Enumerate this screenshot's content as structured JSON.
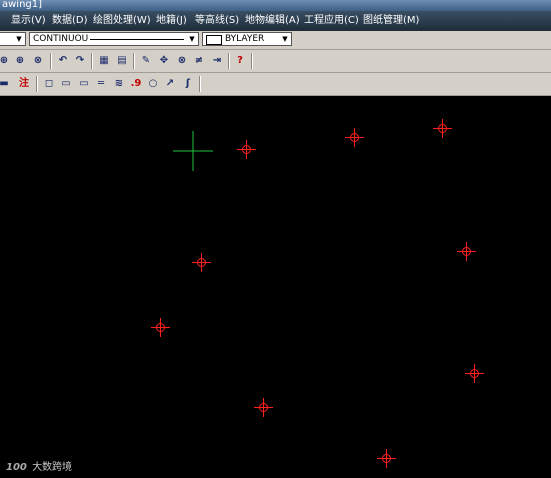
{
  "window": {
    "title": "awing1]"
  },
  "menu": [
    {
      "label": "显示(V)"
    },
    {
      "label": "数据(D)"
    },
    {
      "label": "绘图处理(W)"
    },
    {
      "label": "地籍(J)"
    },
    {
      "label": "等高线(S)"
    },
    {
      "label": "地物编辑(A)"
    },
    {
      "label": "工程应用(C)"
    },
    {
      "label": "图纸管理(M)"
    }
  ],
  "properties": {
    "layer": "",
    "linetype": "CONTINUOU",
    "color": "BYLAYER"
  },
  "toolbar1": [
    {
      "icon": "zoom-window-icon",
      "glyph": "⊕"
    },
    {
      "icon": "zoom-extents-icon",
      "glyph": "⊕"
    },
    {
      "icon": "zoom-previous-icon",
      "glyph": "⊗"
    },
    {
      "icon": "undo-icon",
      "glyph": "↶"
    },
    {
      "icon": "redo-icon",
      "glyph": "↷"
    },
    {
      "icon": "properties-icon",
      "glyph": "▦"
    },
    {
      "icon": "layer-list-icon",
      "glyph": "▤"
    },
    {
      "icon": "pencil-icon",
      "glyph": "✎"
    },
    {
      "icon": "move-icon",
      "glyph": "✥"
    },
    {
      "icon": "copy-icon",
      "glyph": "⊗"
    },
    {
      "icon": "trim-icon",
      "glyph": "≠"
    },
    {
      "icon": "extend-icon",
      "glyph": "⇥"
    },
    {
      "icon": "help-icon",
      "glyph": "?"
    }
  ],
  "toolbar2": [
    {
      "icon": "ruler-icon",
      "glyph": "▬"
    },
    {
      "icon": "annotate-icon",
      "glyph": "注"
    },
    {
      "icon": "rectangle-icon",
      "glyph": "◻"
    },
    {
      "icon": "rectangle-filled-icon",
      "glyph": "▭"
    },
    {
      "icon": "line-bar-icon",
      "glyph": "▭"
    },
    {
      "icon": "double-line-icon",
      "glyph": "═"
    },
    {
      "icon": "fence-icon",
      "glyph": "≋"
    },
    {
      "icon": "elevation-point-icon",
      "glyph": ".9"
    },
    {
      "icon": "circle-icon",
      "glyph": "○"
    },
    {
      "icon": "arrow-icon",
      "glyph": "↗"
    },
    {
      "icon": "curve-icon",
      "glyph": "ʃ"
    }
  ],
  "canvas": {
    "background": "#000000",
    "point_color": "#ff2020",
    "cursor_color": "#20c040",
    "survey_points": [
      {
        "id": "p1"
      },
      {
        "id": "p2"
      },
      {
        "id": "p3"
      },
      {
        "id": "p4"
      },
      {
        "id": "p5"
      },
      {
        "id": "p6"
      },
      {
        "id": "p7"
      },
      {
        "id": "p8"
      },
      {
        "id": "p9"
      },
      {
        "id": "p10"
      }
    ]
  },
  "watermark": {
    "logo": "100",
    "text": "大数跨境"
  }
}
